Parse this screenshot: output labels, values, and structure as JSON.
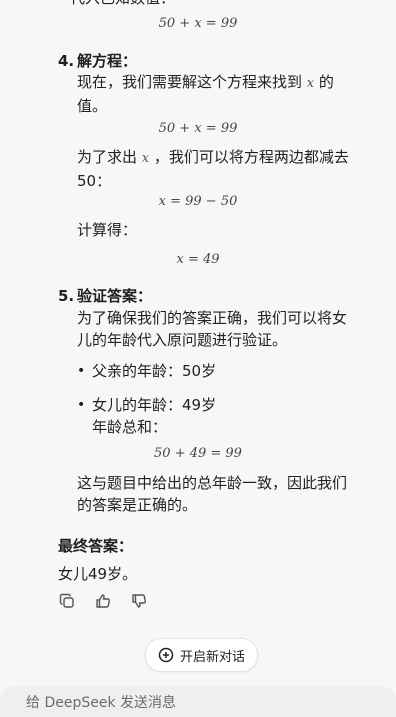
{
  "cut_text": "代入已知数值：",
  "formulas": [
    "50 + x = 99",
    "50 + x = 99",
    "x = 99 − 50",
    "x = 49",
    "50 + 49 = 99"
  ],
  "step4": {
    "number": "4.",
    "title": "解方程：",
    "para1_a": "现在，我们需要解这个方程来找到",
    "para1_var": "x",
    "para1_b": "的",
    "para1_c": "值。",
    "para2_a": "为了求出",
    "para2_var": "x",
    "para2_b": "，我们可以将方程两边都减去",
    "para2_c": "50：",
    "para3": "计算得："
  },
  "step5": {
    "number": "5.",
    "title": "验证答案：",
    "para1_line1": "为了确保我们的答案正确，我们可以将女",
    "para1_line2": "儿的年龄代入原问题进行验证。",
    "bullet1": "父亲的年龄：50岁",
    "bullet2": "女儿的年龄：49岁",
    "sub_text": "年龄总和：",
    "para2_line1": "这与题目中给出的总年龄一致，因此我们",
    "para2_line2": "的答案是正确的。"
  },
  "final": {
    "title": "最终答案：",
    "text": "女儿49岁。"
  },
  "actions": {
    "icons": [
      "copy-icon",
      "thumbs-up-icon",
      "thumbs-down-icon"
    ]
  },
  "new_chat_label": "开启新对话",
  "input_placeholder": "给 DeepSeek 发送消息"
}
